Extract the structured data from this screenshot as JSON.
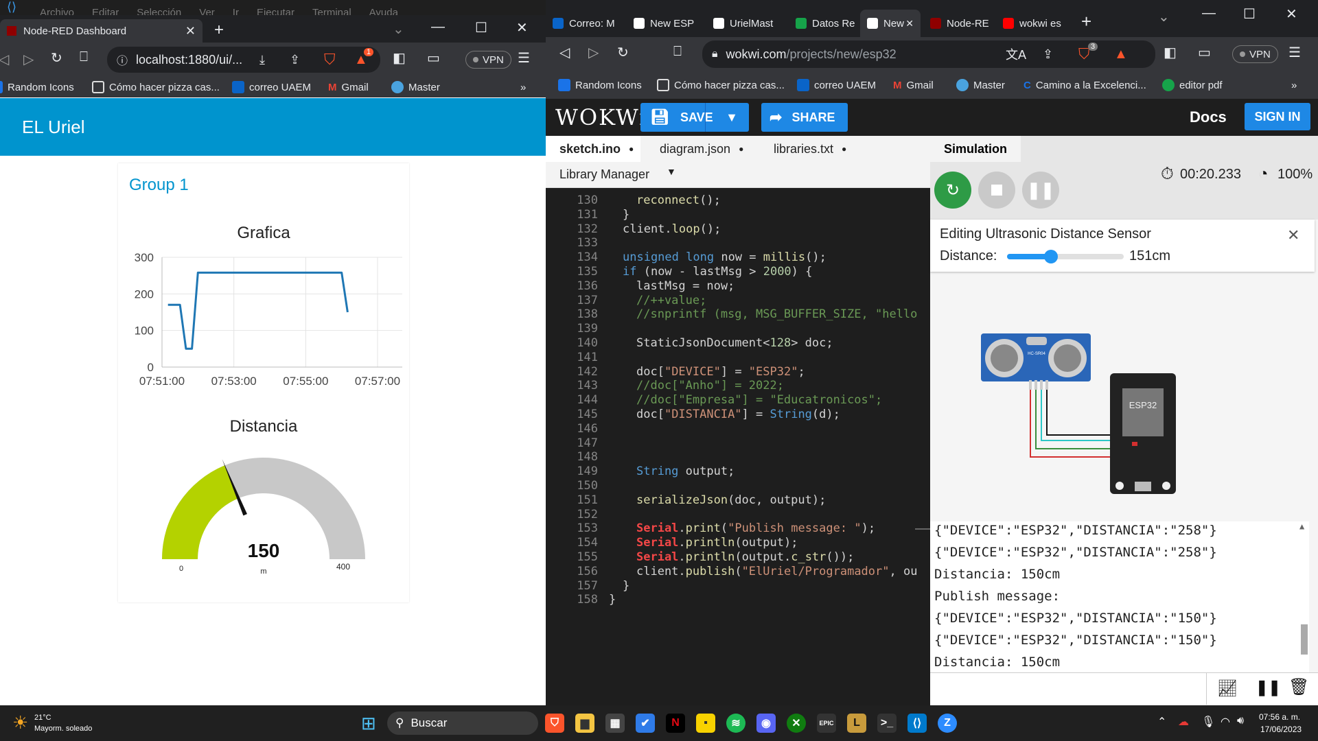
{
  "background_menu": [
    "Archivo",
    "Editar",
    "Selección",
    "Ver",
    "Ir",
    "Ejecutar",
    "Terminal",
    "Ayuda"
  ],
  "left_browser": {
    "tab_title": "Node-RED Dashboard",
    "url": "localhost:1880/ui/...",
    "vpn_label": "VPN",
    "brave_badge": "1",
    "bookmarks": [
      "Random Icons",
      "Cómo hacer pizza cas...",
      "correo UAEM",
      "Gmail",
      "Master"
    ],
    "more": "»"
  },
  "dashboard": {
    "header_title": "EL Uriel",
    "group_title": "Group 1",
    "chart_title": "Grafica",
    "gauge_title": "Distancia",
    "gauge_value": "150",
    "gauge_units": "m",
    "gauge_min": "0",
    "gauge_max": "400"
  },
  "chart_data": {
    "type": "line",
    "title": "Grafica",
    "xlabel": "",
    "ylabel": "",
    "x_tick_labels": [
      "07:51:00",
      "07:53:00",
      "07:55:00",
      "07:57:00"
    ],
    "y_tick_labels": [
      "0",
      "100",
      "200",
      "300"
    ],
    "ylim": [
      0,
      300
    ],
    "xlim_minutes": [
      51,
      57
    ],
    "grid": true,
    "series": [
      {
        "color": "#1f77b4",
        "points": [
          {
            "x": "07:51:10",
            "y": 170
          },
          {
            "x": "07:51:30",
            "y": 170
          },
          {
            "x": "07:51:40",
            "y": 50
          },
          {
            "x": "07:51:50",
            "y": 50
          },
          {
            "x": "07:52:00",
            "y": 258
          },
          {
            "x": "07:55:00",
            "y": 258
          },
          {
            "x": "07:56:00",
            "y": 258
          },
          {
            "x": "07:56:10",
            "y": 150
          }
        ]
      }
    ]
  },
  "gauge": {
    "value": 150,
    "min": 0,
    "max": 400,
    "fill_color": "#b4d200",
    "track_color": "#c8c8c8"
  },
  "right_browser": {
    "tabs": [
      "Correo: M",
      "New ESP",
      "UrielMast",
      "Datos Re",
      "New",
      "Node-RE",
      "wokwi es"
    ],
    "active_tab_index": 4,
    "url_host": "wokwi.com",
    "url_path": "/projects/new/esp32",
    "vpn_label": "VPN",
    "brave_badge": "3",
    "bookmarks": [
      "Random Icons",
      "Cómo hacer pizza cas...",
      "correo UAEM",
      "Gmail",
      "Master",
      "Camino a la Excelenci...",
      "editor pdf"
    ],
    "more": "»"
  },
  "wokwi": {
    "logo": "WOKWi",
    "save_label": "SAVE",
    "share_label": "SHARE",
    "docs_label": "Docs",
    "signin_label": "SIGN IN",
    "editor_tabs": [
      "sketch.ino",
      "diagram.json",
      "libraries.txt"
    ],
    "library_manager": "Library Manager",
    "simulation_tab": "Simulation",
    "timer": "00:20.233",
    "speed": "100%",
    "edit_title": "Editing Ultrasonic Distance Sensor",
    "distance_label": "Distance:",
    "distance_value": "151cm",
    "distance_slider_fraction": 0.378,
    "board_label": "ESP32",
    "sensor_label": "HC-SR04"
  },
  "code_lines": [
    {
      "n": "130",
      "text": "reconnect();"
    },
    {
      "n": "131",
      "text": "}"
    },
    {
      "n": "132",
      "text": "client.loop();"
    },
    {
      "n": "133",
      "text": ""
    },
    {
      "n": "134",
      "text": "unsigned long now = millis();"
    },
    {
      "n": "135",
      "text": "if (now - lastMsg > 2000) {"
    },
    {
      "n": "136",
      "text": "lastMsg = now;"
    },
    {
      "n": "137",
      "text": "//++value;"
    },
    {
      "n": "138",
      "text": "//snprintf (msg, MSG_BUFFER_SIZE, \"hello"
    },
    {
      "n": "139",
      "text": ""
    },
    {
      "n": "140",
      "text": "StaticJsonDocument<128> doc;"
    },
    {
      "n": "141",
      "text": ""
    },
    {
      "n": "142",
      "text": "doc[\"DEVICE\"] = \"ESP32\";"
    },
    {
      "n": "143",
      "text": "//doc[\"Anho\"] = 2022;"
    },
    {
      "n": "144",
      "text": "//doc[\"Empresa\"] = \"Educatronicos\";"
    },
    {
      "n": "145",
      "text": "doc[\"DISTANCIA\"] = String(d);"
    },
    {
      "n": "146",
      "text": ""
    },
    {
      "n": "147",
      "text": ""
    },
    {
      "n": "148",
      "text": ""
    },
    {
      "n": "149",
      "text": "String output;"
    },
    {
      "n": "150",
      "text": ""
    },
    {
      "n": "151",
      "text": "serializeJson(doc, output);"
    },
    {
      "n": "152",
      "text": ""
    },
    {
      "n": "153",
      "text": "Serial.print(\"Publish message: \");"
    },
    {
      "n": "154",
      "text": "Serial.println(output);"
    },
    {
      "n": "155",
      "text": "Serial.println(output.c_str());"
    },
    {
      "n": "156",
      "text": "client.publish(\"ElUriel/Programador\", ou"
    },
    {
      "n": "157",
      "text": "}"
    },
    {
      "n": "158",
      "text": "}"
    }
  ],
  "serial_lines": [
    "{\"DEVICE\":\"ESP32\",\"DISTANCIA\":\"258\"}",
    "{\"DEVICE\":\"ESP32\",\"DISTANCIA\":\"258\"}",
    "Distancia: 150cm",
    "Publish message:",
    "{\"DEVICE\":\"ESP32\",\"DISTANCIA\":\"150\"}",
    "{\"DEVICE\":\"ESP32\",\"DISTANCIA\":\"150\"}",
    "Distancia: 150cm"
  ],
  "taskbar": {
    "weather_temp": "21°C",
    "weather_desc": "Mayorm. soleado",
    "search_label": "Buscar",
    "time": "07:56 a. m.",
    "date": "17/06/2023"
  }
}
